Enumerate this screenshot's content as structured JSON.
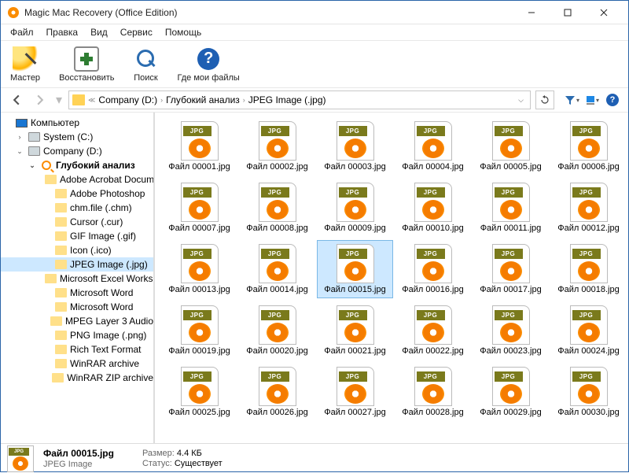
{
  "window": {
    "title": "Magic Mac Recovery (Office Edition)"
  },
  "menu": [
    "Файл",
    "Правка",
    "Вид",
    "Сервис",
    "Помощь"
  ],
  "toolbar": {
    "wizard": "Мастер",
    "recover": "Восстановить",
    "search": "Поиск",
    "where": "Где мои файлы"
  },
  "path": {
    "seg1": "Company (D:)",
    "seg2": "Глубокий анализ",
    "seg3": "JPEG Image (.jpg)"
  },
  "tree": {
    "computer": "Компьютер",
    "system_c": "System (C:)",
    "company_d": "Company (D:)",
    "deep": "Глубокий анализ",
    "folders": [
      "Adobe Acrobat Document",
      "Adobe Photoshop",
      "chm.file (.chm)",
      "Cursor (.cur)",
      "GIF Image (.gif)",
      "Icon (.ico)",
      "JPEG Image (.jpg)",
      "Microsoft Excel Worksheet",
      "Microsoft Word",
      "Microsoft Word",
      "MPEG Layer 3 Audio",
      "PNG Image (.png)",
      "Rich Text Format",
      "WinRAR archive",
      "WinRAR ZIP archive"
    ]
  },
  "badge": "JPG",
  "files": [
    "Файл 00001.jpg",
    "Файл 00002.jpg",
    "Файл 00003.jpg",
    "Файл 00004.jpg",
    "Файл 00005.jpg",
    "Файл 00006.jpg",
    "Файл 00007.jpg",
    "Файл 00008.jpg",
    "Файл 00009.jpg",
    "Файл 00010.jpg",
    "Файл 00011.jpg",
    "Файл 00012.jpg",
    "Файл 00013.jpg",
    "Файл 00014.jpg",
    "Файл 00015.jpg",
    "Файл 00016.jpg",
    "Файл 00017.jpg",
    "Файл 00018.jpg",
    "Файл 00019.jpg",
    "Файл 00020.jpg",
    "Файл 00021.jpg",
    "Файл 00022.jpg",
    "Файл 00023.jpg",
    "Файл 00024.jpg",
    "Файл 00025.jpg",
    "Файл 00026.jpg",
    "Файл 00027.jpg",
    "Файл 00028.jpg",
    "Файл 00029.jpg",
    "Файл 00030.jpg"
  ],
  "selected_index": 14,
  "details": {
    "name": "Файл 00015.jpg",
    "type": "JPEG Image",
    "size_label": "Размер:",
    "size_value": "4.4 КБ",
    "status_label": "Статус:",
    "status_value": "Существует"
  }
}
